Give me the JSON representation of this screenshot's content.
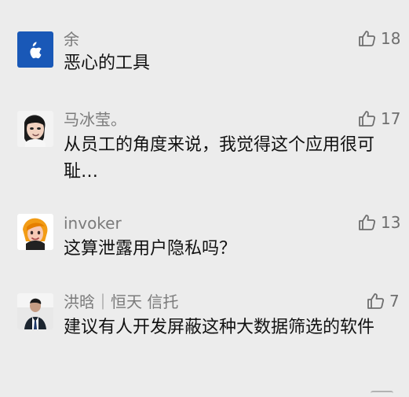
{
  "comments": [
    {
      "name": "余",
      "text": "恶心的工具",
      "likes": "18",
      "avatar_icon": "apple-logo-icon"
    },
    {
      "name": "马冰莹。",
      "text": "从员工的角度来说，我觉得这个应用很可耻…",
      "likes": "17",
      "avatar_icon": "cartoon-girl-avatar-icon"
    },
    {
      "name": "invoker",
      "text": "这算泄露用户隐私吗？",
      "likes": "13",
      "avatar_icon": "cartoon-orange-hair-avatar-icon"
    },
    {
      "name": "洪晗｜恒天 信托",
      "text": "建议有人开发屏蔽这种大数据筛选的软件",
      "likes": "7",
      "avatar_icon": "person-photo-avatar-icon"
    }
  ],
  "icons": {
    "like": "thumb-up-icon"
  },
  "colors": {
    "background": "#ececec",
    "name": "#7b7b7b",
    "text": "#111111",
    "likes": "#6f6f6f"
  }
}
